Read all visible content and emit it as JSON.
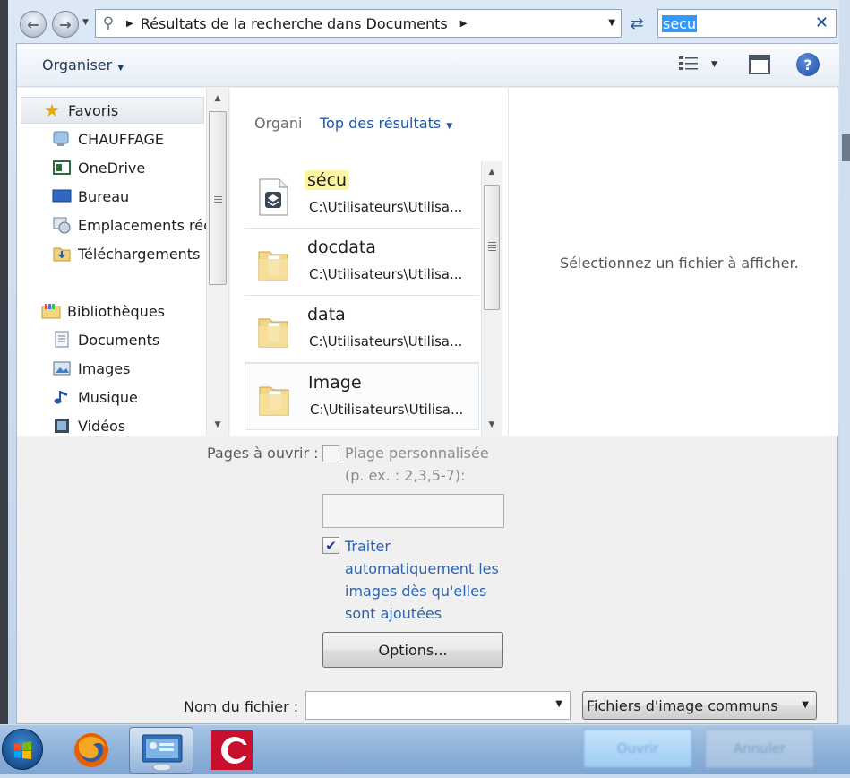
{
  "address_bar": {
    "path": "Résultats de la recherche dans Documents",
    "search_value": "secu"
  },
  "toolbar": {
    "organize_label": "Organiser",
    "help_icon": "help-icon"
  },
  "nav_pane": {
    "favorites_label": "Favoris",
    "favorites": [
      {
        "label": "CHAUFFAGE",
        "icon": "network-drive-icon"
      },
      {
        "label": "OneDrive",
        "icon": "onedrive-icon"
      },
      {
        "label": "Bureau",
        "icon": "desktop-icon"
      },
      {
        "label": "Emplacements récents",
        "icon": "recent-places-icon"
      },
      {
        "label": "Téléchargements",
        "icon": "downloads-icon"
      }
    ],
    "libraries_label": "Bibliothèques",
    "libraries": [
      {
        "label": "Documents",
        "icon": "documents-icon"
      },
      {
        "label": "Images",
        "icon": "pictures-icon"
      },
      {
        "label": "Musique",
        "icon": "music-icon"
      },
      {
        "label": "Vidéos",
        "icon": "videos-icon"
      }
    ]
  },
  "results_pane": {
    "organize_label": "Organi",
    "arrange_label": "Top des résultats",
    "items": [
      {
        "name": "sécu",
        "path": "C:\\Utilisateurs\\Utilisa...",
        "icon": "file-icon"
      },
      {
        "name": "docdata",
        "path": "C:\\Utilisateurs\\Utilisa...",
        "icon": "folder-icon"
      },
      {
        "name": "data",
        "path": "C:\\Utilisateurs\\Utilisa...",
        "icon": "folder-icon"
      },
      {
        "name": "Image",
        "path": "C:\\Utilisateurs\\Utilisa...",
        "icon": "folder-icon"
      }
    ]
  },
  "preview_pane": {
    "message": "Sélectionnez un fichier à afficher."
  },
  "options": {
    "pages_label": "Pages à ouvrir :",
    "custom_range_label": "Plage personnalisée",
    "custom_range_hint": "(p. ex. : 2,3,5-7):",
    "custom_range_value": "",
    "auto_process_lines": [
      "Traiter",
      "automatiquement les",
      "images dès qu'elles",
      "sont ajoutées"
    ],
    "auto_process_checked": true,
    "options_button": "Options..."
  },
  "file_row": {
    "filename_label": "Nom du fichier :",
    "filename_value": "",
    "filetype_value": "Fichiers d'image communs"
  },
  "taskbar": {
    "open_label": "Ouvrir",
    "cancel_label": "Annuler"
  },
  "colors": {
    "accent_blue": "#1f58a6",
    "highlight_yellow": "#fdf6a0",
    "selection_blue": "#3399ff"
  }
}
